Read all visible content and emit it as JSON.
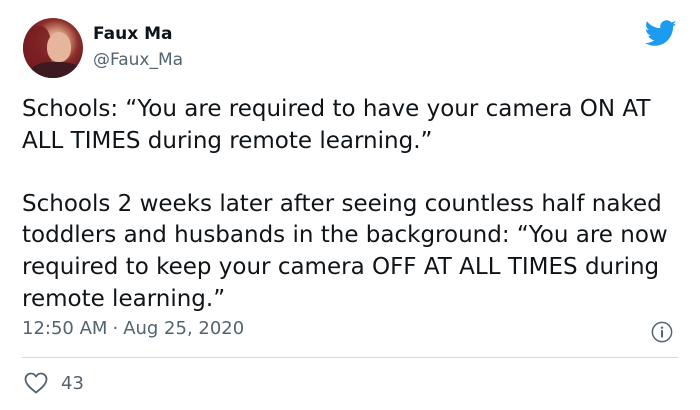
{
  "author": {
    "display_name": "Faux Ma",
    "handle": "@Faux_Ma"
  },
  "tweet": {
    "text": "Schools: “You are required to have your camera ON AT ALL TIMES during remote learning.”\n\nSchools 2 weeks later after seeing countless half naked toddlers and husbands in the background: “You are now required to keep your camera OFF AT ALL TIMES during remote learning.”",
    "time": "12:50 AM",
    "separator": "·",
    "date": "Aug 25, 2020",
    "like_count": "43"
  },
  "icons": {
    "brand": "twitter-bird-icon",
    "info": "info-icon",
    "like": "heart-icon"
  },
  "colors": {
    "brand_blue": "#1d9bf0",
    "text": "#0f1419",
    "muted": "#536471",
    "divider": "#cfd9de"
  }
}
